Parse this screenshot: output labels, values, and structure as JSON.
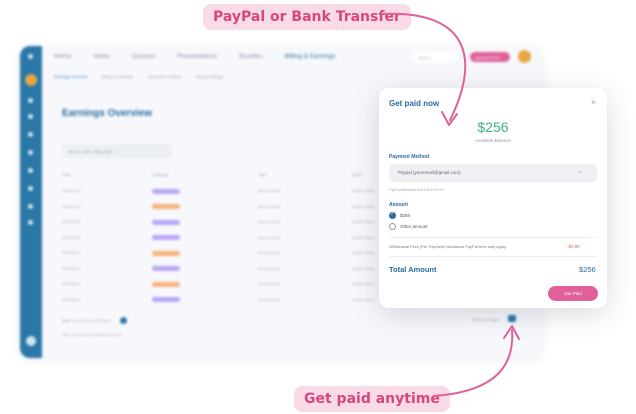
{
  "callouts": {
    "top": "PayPal or Bank Transfer",
    "bottom": "Get paid anytime"
  },
  "app": {
    "nav": [
      "Home",
      "Video",
      "Quizzes",
      "Presentations",
      "Bundles",
      "Billing & Earnings"
    ],
    "search_placeholder": "Search",
    "upgrade_label": "Upgrade Now",
    "subtabs": [
      "Earnings Overview",
      "Billing & Earnings",
      "Transaction History",
      "Payout Settings"
    ],
    "page_title": "Earnings Overview",
    "date_range": "Jan 01, 2023 - May 2023",
    "columns": [
      "Date",
      "Category",
      "Type",
      "Name"
    ],
    "rows": [
      {
        "date": "00/00/0000",
        "category": "Video Lesson",
        "color": "#b9a6f5",
        "type": "New purchase",
        "name": "Modern Physi..."
      },
      {
        "date": "00/00/0000",
        "category": "Presentation",
        "color": "#f7b27a",
        "type": "New purchase",
        "name": "Modern Physi..."
      },
      {
        "date": "00/00/0000",
        "category": "Video Lesson",
        "color": "#b9a6f5",
        "type": "New purchase",
        "name": "Modern Physi..."
      },
      {
        "date": "00/00/0000",
        "category": "Video Lesson",
        "color": "#b9a6f5",
        "type": "New purchase",
        "name": "Modern Physi..."
      },
      {
        "date": "00/00/0000",
        "category": "Presentation",
        "color": "#f7b27a",
        "type": "New purchase",
        "name": "Modern Physi..."
      },
      {
        "date": "00/00/0000",
        "category": "Video Lesson",
        "color": "#b9a6f5",
        "type": "New purchase",
        "name": "Modern Physi..."
      },
      {
        "date": "00/00/0000",
        "category": "Presentation",
        "color": "#f7b27a",
        "type": "New purchase",
        "name": "Modern Physi..."
      },
      {
        "date": "00/00/0000",
        "category": "Video Lesson",
        "color": "#b9a6f5",
        "type": "New purchase",
        "name": "Modern Physi..."
      }
    ],
    "pager": "Back  1  2  3  4  5  6  7  8  9    Next",
    "note": "Note: The report is updated every hour",
    "per_page": "Items per page"
  },
  "modal": {
    "title": "Get paid now",
    "close": "×",
    "amount": "$256",
    "balance_label": "Available Balance",
    "payment_method_label": "Payment Method",
    "payment_method_value": "Paypal (youremail@gmail.com)",
    "withdrawal_note": "PayPal withdrawal limit is $15,000.00",
    "amount_label": "Amount",
    "options": [
      "$256",
      "Other amount"
    ],
    "selected_option": "$256",
    "fees_label": "Withdrawal Fees (Per Payment) Additional PayPal fees may apply.",
    "fees_value": "-$0.00",
    "total_label": "Total Amount",
    "total_value": "$256",
    "get_paid_label": "Get Paid"
  },
  "colors": {
    "accent_pink": "#e0609a",
    "brand_blue": "#2a6c9e",
    "amount_green": "#41b07a",
    "fee_red": "#e06a4a"
  }
}
